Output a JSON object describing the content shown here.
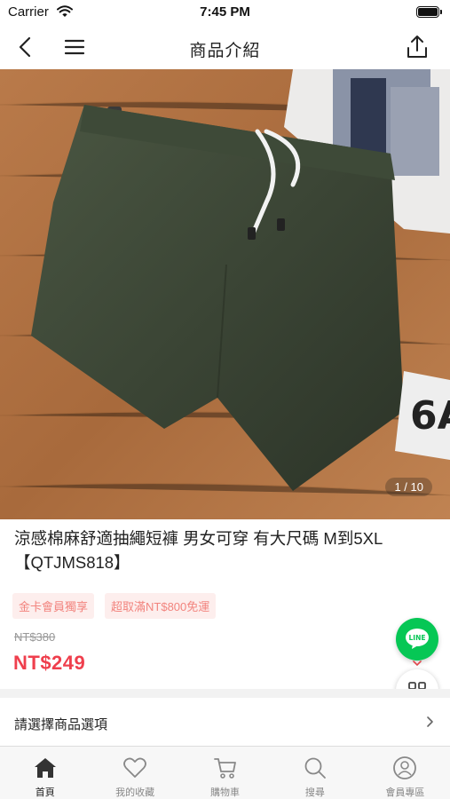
{
  "status_bar": {
    "carrier": "Carrier",
    "time": "7:45 PM"
  },
  "nav": {
    "title": "商品介紹"
  },
  "gallery": {
    "indicator": "1 / 10"
  },
  "product": {
    "title": "涼感棉麻舒適抽繩短褲 男女可穿 有大尺碼 M到5XL【QTJMS818】",
    "tags": [
      "金卡會員獨享",
      "超取滿NT$800免運"
    ],
    "original_price": "NT$380",
    "sale_price": "NT$249"
  },
  "options": {
    "label": "請選擇商品選項"
  },
  "floating": {
    "line_label": "LINE"
  },
  "tabs": [
    {
      "label": "首頁",
      "icon": "home-icon",
      "active": true
    },
    {
      "label": "我的收藏",
      "icon": "heart-icon",
      "active": false
    },
    {
      "label": "購物車",
      "icon": "cart-icon",
      "active": false
    },
    {
      "label": "搜尋",
      "icon": "search-icon",
      "active": false
    },
    {
      "label": "會員專區",
      "icon": "user-icon",
      "active": false
    }
  ],
  "colors": {
    "accent": "#ef3f4d",
    "tag_bg": "#fdeeed",
    "tag_text": "#f2847e",
    "line_green": "#06c755"
  }
}
